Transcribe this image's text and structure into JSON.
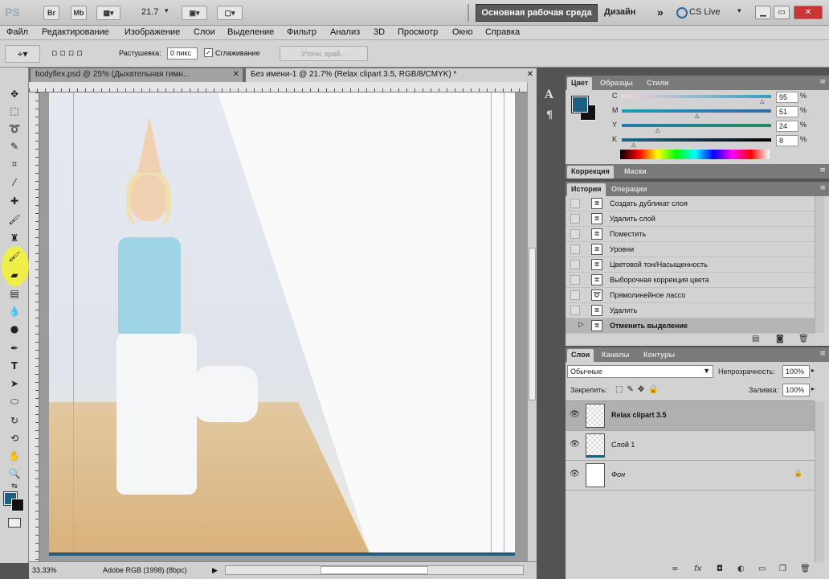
{
  "appbar": {
    "logo": "PS",
    "br": "Br",
    "mb": "Mb",
    "zoom": "21.7",
    "workspace_active": "Основная рабочая среда",
    "workspace_design": "Дизайн",
    "more": "»",
    "cslive": "CS Live"
  },
  "menu": [
    "Файл",
    "Редактирование",
    "Изображение",
    "Слои",
    "Выделение",
    "Фильтр",
    "Анализ",
    "3D",
    "Просмотр",
    "Окно",
    "Справка"
  ],
  "options": {
    "feather_label": "Растушевка:",
    "feather_value": "0 пикс",
    "antialias_label": "Сглаживание",
    "refine_label": "Уточн. край..."
  },
  "doc_tabs": [
    {
      "label": "bodyflex.psd @ 25% (Дыхательная гимн..."
    },
    {
      "label": "Без имени-1 @ 21.7% (Relax clipart 3.5, RGB/8/CMYK) *"
    }
  ],
  "status": {
    "zoom": "33.33%",
    "profile": "Adobe RGB (1998) (8bpc)"
  },
  "color_panel": {
    "tabs": [
      "Цвет",
      "Образцы",
      "Стили"
    ],
    "channels": [
      {
        "label": "C",
        "value": "95",
        "pct": "%",
        "level": 95
      },
      {
        "label": "M",
        "value": "51",
        "pct": "%",
        "level": 51
      },
      {
        "label": "Y",
        "value": "24",
        "pct": "%",
        "level": 24
      },
      {
        "label": "K",
        "value": "8",
        "pct": "%",
        "level": 8
      }
    ],
    "fg_color": "#1d5f82",
    "bg_color": "#111111"
  },
  "adjust_panel": {
    "tabs": [
      "Коррекция",
      "Маски"
    ]
  },
  "history_panel": {
    "tabs": [
      "История",
      "Операции"
    ],
    "items": [
      "Создать дубликат слоя",
      "Удалить слой",
      "Поместить",
      "Уровни",
      "Цветовой тон/Насыщенность",
      "Выборочная коррекция цвета",
      "Прямолинейное лассо",
      "Удалить",
      "Отменить выделение"
    ]
  },
  "layers_panel": {
    "tabs": [
      "Слои",
      "Каналы",
      "Контуры"
    ],
    "blend_mode": "Обычные",
    "opacity_label": "Непрозрачность:",
    "opacity_value": "100%",
    "lock_label": "Закрепить:",
    "fill_label": "Заливка:",
    "fill_value": "100%",
    "layers": [
      {
        "name": "Relax clipart 3.5"
      },
      {
        "name": "Слой 1"
      },
      {
        "name": "Фон"
      }
    ]
  }
}
